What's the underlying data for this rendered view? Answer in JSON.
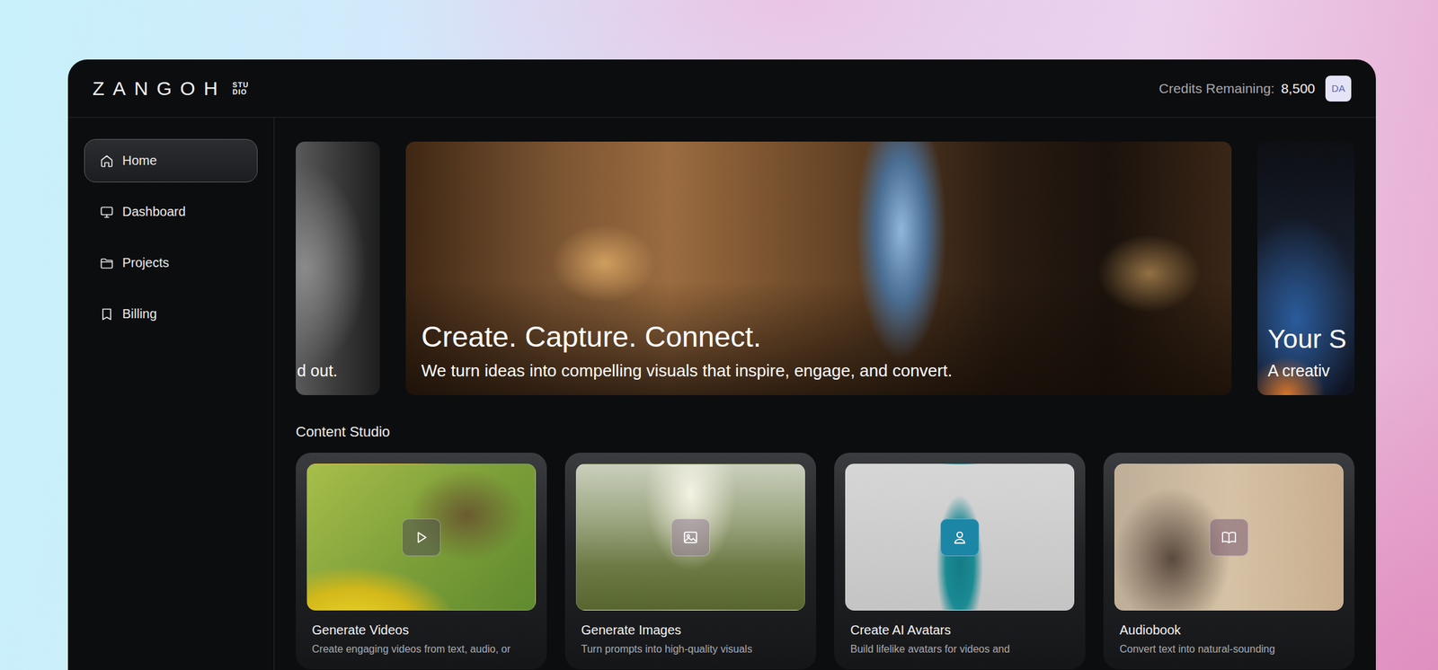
{
  "header": {
    "logo": "ZANGOH",
    "logo_badge": [
      "STU",
      "DIO"
    ],
    "credits_label": "Credits Remaining:",
    "credits_value": "8,500",
    "avatar": "DA"
  },
  "sidebar": {
    "items": [
      {
        "label": "Home",
        "selected": true
      },
      {
        "label": "Dashboard",
        "selected": false
      },
      {
        "label": "Projects",
        "selected": false
      },
      {
        "label": "Billing",
        "selected": false
      }
    ]
  },
  "carousel": {
    "slides": [
      {
        "title": "",
        "subtitle": "d out.",
        "selected": false
      },
      {
        "title": "Create. Capture. Connect.",
        "subtitle": "We turn ideas into compelling visuals that inspire, engage, and convert.",
        "selected": true
      },
      {
        "title": "Your S",
        "subtitle": "A creativ",
        "selected": false
      }
    ]
  },
  "content_studio": {
    "heading": "Content Studio",
    "cards": [
      {
        "title": "Generate Videos",
        "description": "Create engaging videos from text, audio, or"
      },
      {
        "title": "Generate Images",
        "description": "Turn prompts into high-quality visuals"
      },
      {
        "title": "Create AI Avatars",
        "description": "Build lifelike avatars for videos and"
      },
      {
        "title": "Audiobook",
        "description": "Convert text into natural-sounding"
      }
    ]
  }
}
